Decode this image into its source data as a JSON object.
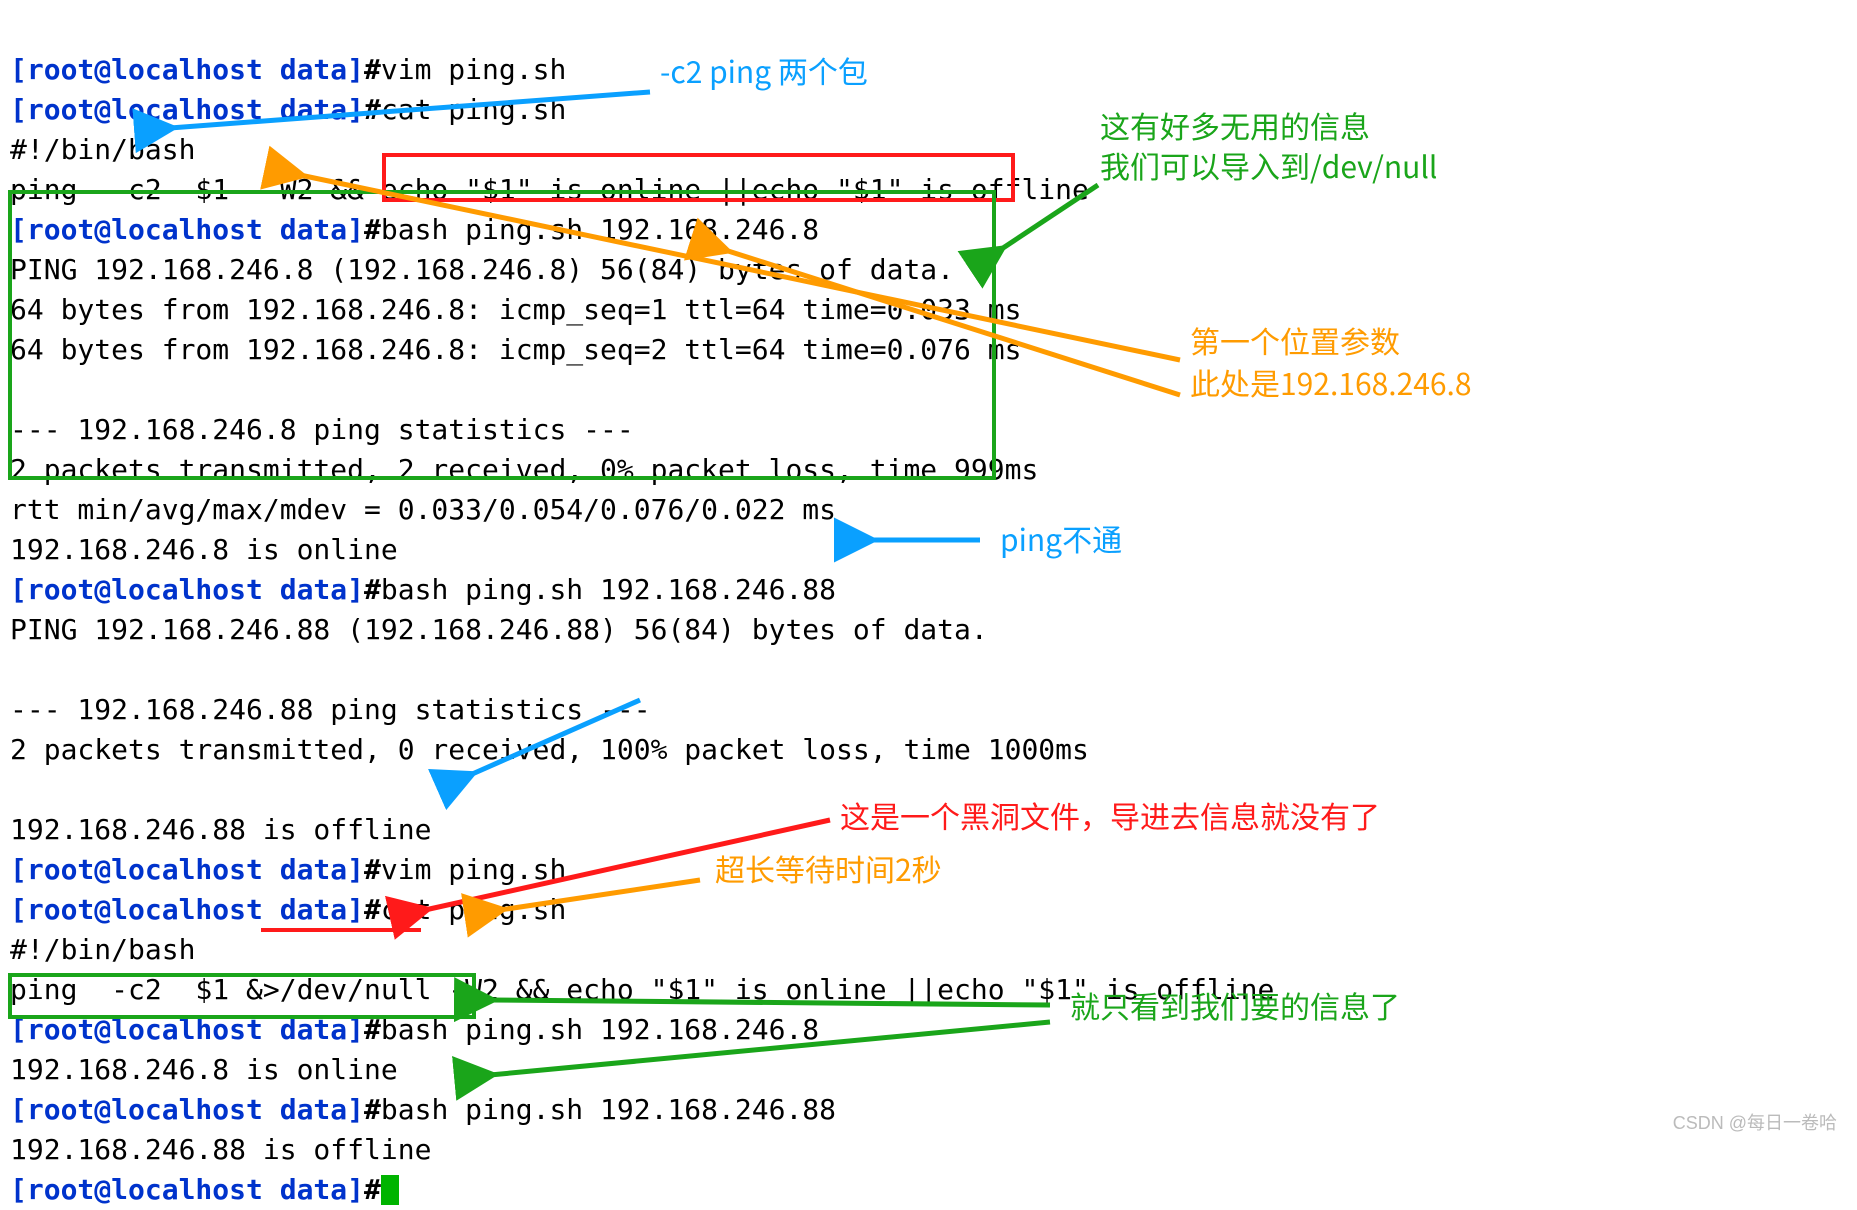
{
  "lines": {
    "l1_prompt": "[root@localhost data]",
    "l1_cmd": "vim ping.sh",
    "l2_prompt": "[root@localhost data]",
    "l2_cmd": "cat ping.sh",
    "l3": "#!/bin/bash",
    "l4": "ping  -c2  $1  -W2 && echo \"$1\" is online ||echo \"$1\" is offline",
    "l5_prompt": "[root@localhost data]",
    "l5_cmd": "bash ping.sh 192.168.246.8",
    "l6": "PING 192.168.246.8 (192.168.246.8) 56(84) bytes of data.",
    "l7": "64 bytes from 192.168.246.8: icmp_seq=1 ttl=64 time=0.033 ms",
    "l8": "64 bytes from 192.168.246.8: icmp_seq=2 ttl=64 time=0.076 ms",
    "l9": "",
    "l10": "--- 192.168.246.8 ping statistics ---",
    "l11": "2 packets transmitted, 2 received, 0% packet loss, time 999ms",
    "l12": "rtt min/avg/max/mdev = 0.033/0.054/0.076/0.022 ms",
    "l13": "192.168.246.8 is online",
    "l14_prompt": "[root@localhost data]",
    "l14_cmd": "bash ping.sh 192.168.246.88",
    "l15": "PING 192.168.246.88 (192.168.246.88) 56(84) bytes of data.",
    "l16": "",
    "l17": "--- 192.168.246.88 ping statistics ---",
    "l18": "2 packets transmitted, 0 received, 100% packet loss, time 1000ms",
    "l19": "",
    "l20": "192.168.246.88 is offline",
    "l21_prompt": "[root@localhost data]",
    "l21_cmd": "vim ping.sh",
    "l22_prompt": "[root@localhost data]",
    "l22_cmd": "cat ping.sh",
    "l23": "#!/bin/bash",
    "l24": "ping  -c2  $1 &>/dev/null -W2 && echo \"$1\" is online ||echo \"$1\" is offline",
    "l25_prompt": "[root@localhost data]",
    "l25_cmd": "bash ping.sh 192.168.246.8",
    "l26": "192.168.246.8 is online",
    "l27_prompt": "[root@localhost data]",
    "l27_cmd": "bash ping.sh 192.168.246.88",
    "l28": "192.168.246.88 is offline",
    "l29_prompt": "[root@localhost data]"
  },
  "hash": "#",
  "annot": {
    "a1": "-c2 ping 两个包",
    "a2a": "这有好多无用的信息",
    "a2b": "我们可以导入到/dev/null",
    "a3a": "第一个位置参数",
    "a3b": "此处是192.168.246.8",
    "a4": "ping不通",
    "a5": "这是一个黑洞文件，导进去信息就没有了",
    "a6": "超长等待时间2秒",
    "a7": "就只看到我们要的信息了"
  },
  "watermark": "CSDN @每日一卷哈"
}
